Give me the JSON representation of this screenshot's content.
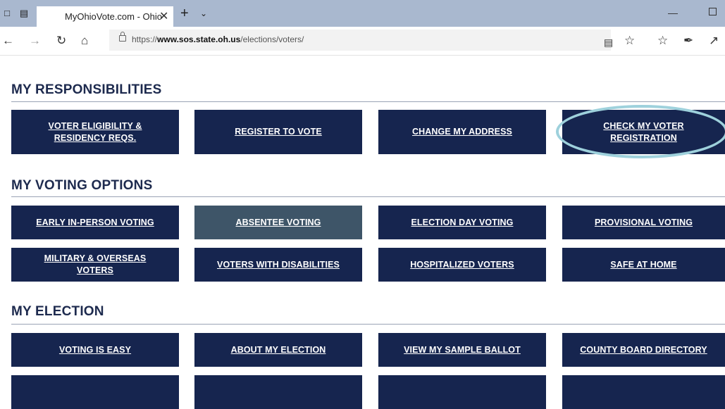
{
  "browser": {
    "tab_title": "MyOhioVote.com - Ohio",
    "tab_close": "✕",
    "new_tab": "+",
    "tab_menu": "⌄",
    "url_scheme": "https://",
    "url_domain": "www.sos.state.oh.us",
    "url_path": "/elections/voters/"
  },
  "sections": {
    "responsibilities": {
      "title": "MY RESPONSIBILITIES",
      "items": [
        "VOTER ELIGIBILITY & RESIDENCY REQS.",
        "REGISTER TO VOTE",
        "CHANGE MY ADDRESS",
        "CHECK MY VOTER REGISTRATION"
      ]
    },
    "voting_options": {
      "title": "MY VOTING OPTIONS",
      "items": [
        "EARLY IN-PERSON VOTING",
        "ABSENTEE VOTING",
        "ELECTION DAY VOTING",
        "PROVISIONAL VOTING",
        "MILITARY & OVERSEAS VOTERS",
        "VOTERS WITH DISABILITIES",
        "HOSPITALIZED VOTERS",
        "SAFE AT HOME"
      ]
    },
    "election": {
      "title": "MY ELECTION",
      "items": [
        "VOTING IS EASY",
        "ABOUT MY ELECTION",
        "VIEW MY SAMPLE BALLOT",
        "COUNTY BOARD DIRECTORY",
        "",
        "",
        "",
        ""
      ]
    }
  },
  "colors": {
    "card": "#16254f",
    "card_hover": "#3e5568",
    "highlight_ring": "#9ed1dc",
    "heading": "#1d2a4e"
  }
}
